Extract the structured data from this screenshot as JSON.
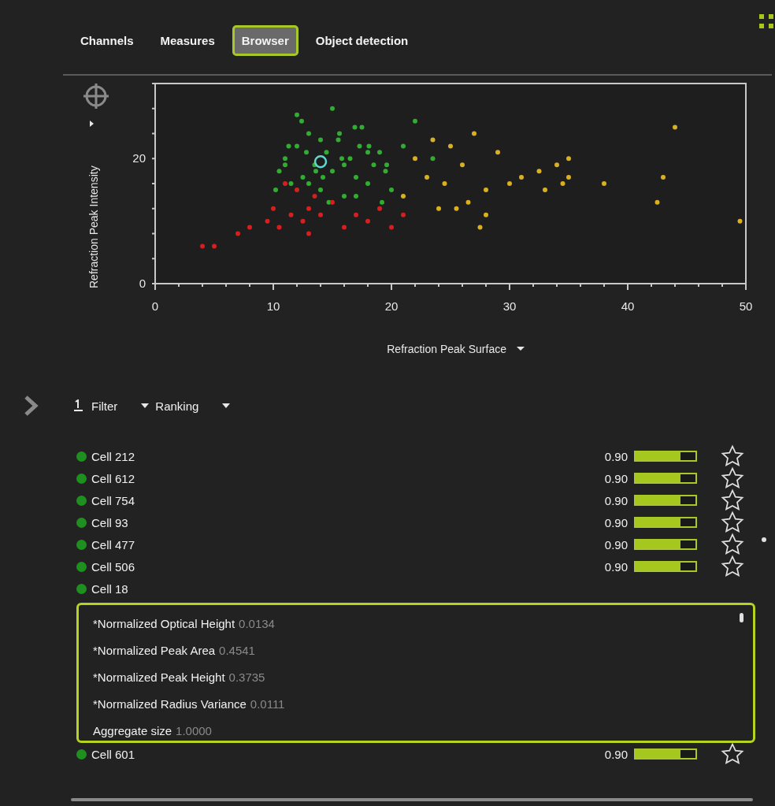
{
  "tabs": [
    {
      "label": "Channels",
      "selected": false
    },
    {
      "label": "Measures",
      "selected": false
    },
    {
      "label": "Browser",
      "selected": true
    },
    {
      "label": "Object detection",
      "selected": false
    }
  ],
  "chart": {
    "chart_data": {
      "type": "scatter",
      "xlabel": "Refraction Peak Surface",
      "ylabel": "Refraction Peak Intensity",
      "xlim": [
        0,
        50
      ],
      "ylim": [
        0,
        32
      ],
      "xticks": [
        0,
        10,
        20,
        30,
        40,
        50
      ],
      "yticks": [
        0,
        20
      ],
      "series": [
        {
          "color": "#2fae2f",
          "x": [
            10.5,
            11,
            11.5,
            12,
            12.5,
            13,
            13.5,
            14,
            14.5,
            15,
            15.5,
            16,
            16.5,
            17,
            17.5,
            18,
            18.5,
            19,
            19.5,
            20,
            10.2,
            11.3,
            12.4,
            13.6,
            14.7,
            15.8,
            16.9,
            18.1,
            19.2,
            12,
            13,
            14,
            15,
            16,
            17,
            18,
            11,
            12.8,
            14.2,
            15.6,
            17.3,
            19.6,
            21,
            22,
            23.5
          ],
          "values": [
            18,
            20,
            16,
            22,
            17,
            24,
            19,
            15,
            21,
            18,
            23,
            14,
            20,
            17,
            25,
            16,
            19,
            21,
            18,
            15,
            15,
            22,
            26,
            18,
            13,
            20,
            25,
            22,
            13,
            27,
            16,
            23,
            28,
            19,
            14,
            21,
            19,
            21,
            17,
            24,
            22,
            19,
            22,
            26,
            20
          ]
        },
        {
          "color": "#d42020",
          "x": [
            4,
            5,
            7,
            8,
            9.5,
            10,
            10.5,
            11,
            11.5,
            12,
            12.5,
            13,
            13,
            13.5,
            14,
            15,
            16,
            17,
            18,
            19,
            20,
            21
          ],
          "values": [
            6,
            6,
            8,
            9,
            10,
            12,
            9,
            16,
            11,
            15,
            10,
            12,
            8,
            14,
            11,
            13,
            9,
            11,
            10,
            12,
            9,
            11
          ]
        },
        {
          "color": "#d8b020",
          "x": [
            21,
            22,
            23,
            24,
            24.5,
            25,
            26,
            26.5,
            27,
            28,
            28,
            29,
            30,
            31,
            32.5,
            33,
            34,
            34.5,
            35,
            35,
            38,
            42.5,
            43,
            44,
            49.5,
            25.5,
            27.5,
            23.5
          ],
          "values": [
            14,
            20,
            17,
            12,
            16,
            22,
            19,
            13,
            24,
            11,
            15,
            21,
            16,
            17,
            18,
            15,
            19,
            16,
            17,
            20,
            16,
            13,
            17,
            25,
            10,
            12,
            9,
            23
          ]
        }
      ]
    }
  },
  "toolbar": {
    "filter_label": "Filter",
    "ranking_label": "Ranking"
  },
  "cells": [
    {
      "name": "Cell 212",
      "score": "0.90",
      "level": 0.75,
      "favorite": false,
      "expanded": false
    },
    {
      "name": "Cell 612",
      "score": "0.90",
      "level": 0.75,
      "favorite": false,
      "expanded": false
    },
    {
      "name": "Cell 754",
      "score": "0.90",
      "level": 0.75,
      "favorite": false,
      "expanded": false
    },
    {
      "name": "Cell 93",
      "score": "0.90",
      "level": 0.75,
      "favorite": false,
      "expanded": false
    },
    {
      "name": "Cell 477",
      "score": "0.90",
      "level": 0.75,
      "favorite": false,
      "expanded": false
    },
    {
      "name": "Cell 506",
      "score": "0.90",
      "level": 0.75,
      "favorite": false,
      "expanded": false
    },
    {
      "name": "Cell 18",
      "expanded": true,
      "details": [
        {
          "label": "*Normalized Optical Height",
          "value": "0.0134"
        },
        {
          "label": "*Normalized Peak Area",
          "value": "0.4541"
        },
        {
          "label": "*Normalized Peak Height",
          "value": "0.3735"
        },
        {
          "label": "*Normalized Radius Variance",
          "value": "0.0111"
        },
        {
          "label": "Aggregate size",
          "value": "1.0000"
        }
      ]
    },
    {
      "name": "Cell 601",
      "score": "0.90",
      "level": 0.75,
      "favorite": false,
      "expanded": false
    }
  ]
}
